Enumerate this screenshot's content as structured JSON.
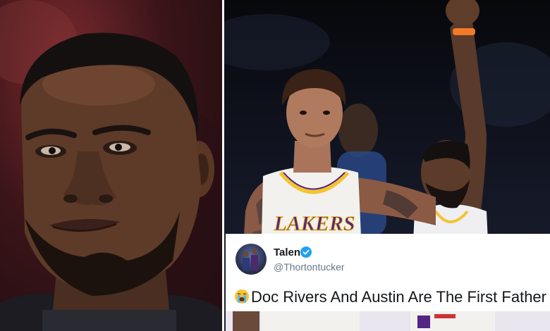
{
  "tweet": {
    "display_name": "Talen",
    "handle": "@Thortontucker",
    "text": "Doc Rivers And Austin Are The First Father A",
    "verified_icon": "verified-badge-icon",
    "emoji_icon": "loudly-crying-face-icon"
  },
  "jersey": {
    "team_text": "LAKERS"
  },
  "colors": {
    "lakers_gold": "#f4c430",
    "lakers_purple": "#552583",
    "twitter_blue": "#1da1f2"
  }
}
